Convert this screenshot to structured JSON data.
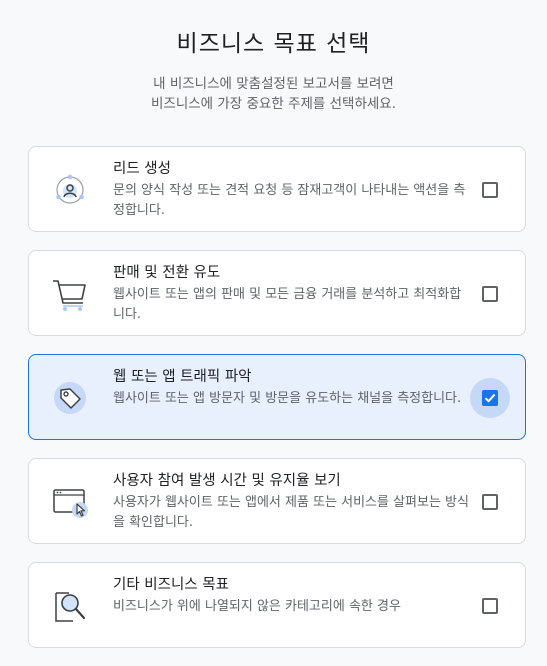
{
  "header": {
    "title": "비즈니스 목표 선택",
    "subtitle_line1": "내 비즈니스에 맞춤설정된 보고서를 보려면",
    "subtitle_line2": "비즈니스에 가장 중요한 주제를 선택하세요."
  },
  "options": [
    {
      "heading": "리드 생성",
      "description": "문의 양식 작성 또는 견적 요청 등 잠재고객이 나타내는 액션을 측정합니다.",
      "icon": "lead-target-icon",
      "checked": false
    },
    {
      "heading": "판매 및 전환 유도",
      "description": "웹사이트 또는 앱의 판매 및 모든 금융 거래를 분석하고 최적화합니다.",
      "icon": "shopping-cart-icon",
      "checked": false
    },
    {
      "heading": "웹 또는 앱 트래픽 파악",
      "description": "웹사이트 또는 앱 방문자 및 방문을 유도하는 채널을 측정합니다.",
      "icon": "tag-icon",
      "checked": true
    },
    {
      "heading": "사용자 참여 발생 시간 및 유지율 보기",
      "description": "사용자가 웹사이트 또는 앱에서 제품 또는 서비스를 살펴보는 방식을 확인합니다.",
      "icon": "browser-cursor-icon",
      "checked": false
    },
    {
      "heading": "기타 비즈니스 목표",
      "description": "비즈니스가 위에 나열되지 않은 카테고리에 속한 경우",
      "icon": "magnifier-icon",
      "checked": false
    }
  ],
  "colors": {
    "accent": "#1a73e8",
    "selected_background": "#e8f0fe",
    "icon_highlight": "#d2e3fc"
  }
}
